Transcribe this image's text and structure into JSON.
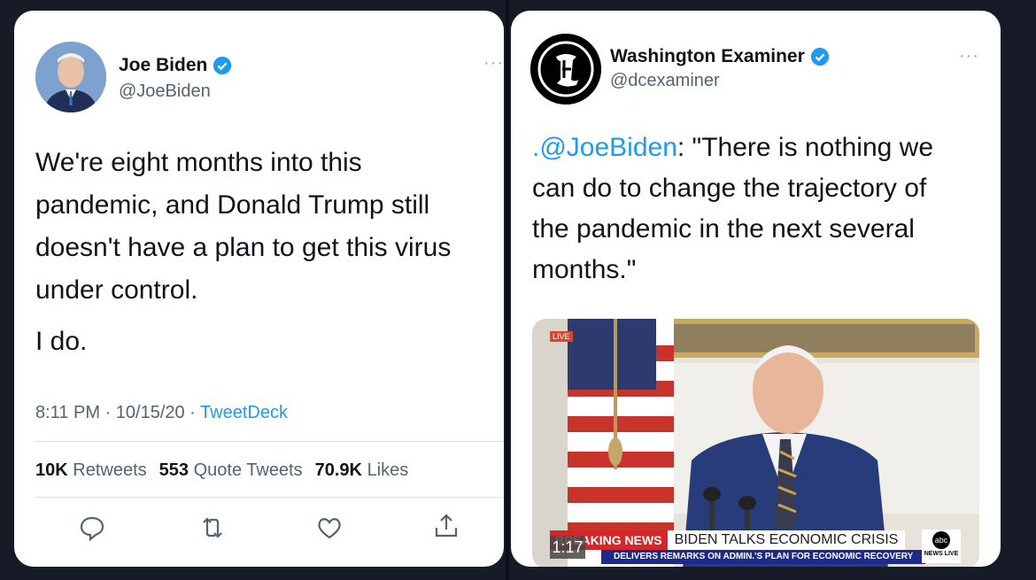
{
  "left_tweet": {
    "display_name": "Joe Biden",
    "handle": "@JoeBiden",
    "more": "···",
    "paragraphs": [
      "We're eight months into this",
      "pandemic, and Donald Trump still",
      "doesn't have a plan to get this virus",
      "under control."
    ],
    "second_paragraph": "I do.",
    "timestamp": "8:11 PM · 10/15/20 · ",
    "source": "TweetDeck",
    "stats": {
      "retweets_count": "10K",
      "retweets_label": "Retweets",
      "quotes_count": "553",
      "quotes_label": "Quote Tweets",
      "likes_count": "70.9K",
      "likes_label": "Likes"
    },
    "actions": [
      "reply-icon",
      "retweet-icon",
      "like-icon",
      "share-icon"
    ]
  },
  "right_tweet": {
    "display_name": "Washington Examiner",
    "handle": "@dcexaminer",
    "more": "···",
    "mention": ".@JoeBiden",
    "lines": [
      ": \"There is nothing we",
      "can do to change the trajectory of",
      "the pandemic in the next several",
      "months.\""
    ],
    "video": {
      "live": "LIVE",
      "tag": "BREAKING NEWS",
      "headline": "BIDEN TALKS ECONOMIC CRISIS",
      "subline": "DELIVERS REMARKS ON ADMIN.'S PLAN FOR ECONOMIC RECOVERY",
      "duration": "1:17",
      "network": "abc",
      "network_sub": "NEWS LIVE"
    }
  },
  "colors": {
    "background": "#161b27",
    "link": "#1d9bf0",
    "verified": "#1d9bf0",
    "text": "#0f1419",
    "muted": "#536471"
  }
}
